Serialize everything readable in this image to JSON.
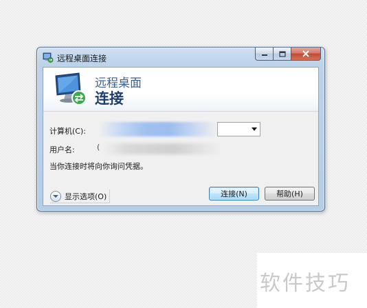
{
  "window": {
    "title": "远程桌面连接",
    "title_icon": "remote-desktop-icon"
  },
  "banner": {
    "line1": "远程桌面",
    "line2": "连接",
    "icon": "remote-desktop-monitor-icon"
  },
  "form": {
    "computer_label": "计算机(C):",
    "user_label": "用户名:",
    "user_value_prefix": "(",
    "credentials_note": "当你连接时将向你询问凭据。"
  },
  "options": {
    "label": "显示选项(O)",
    "icon": "expand-down-icon"
  },
  "buttons": {
    "connect_label": "连接(N)",
    "help_label": "帮助(H)"
  },
  "watermark": {
    "text": "软件技巧"
  },
  "colors": {
    "title_line1": "#3b5f8f",
    "title_line2": "#1f3d6d",
    "close_button": "#c34a34",
    "default_button_border": "#3c7fb1"
  }
}
